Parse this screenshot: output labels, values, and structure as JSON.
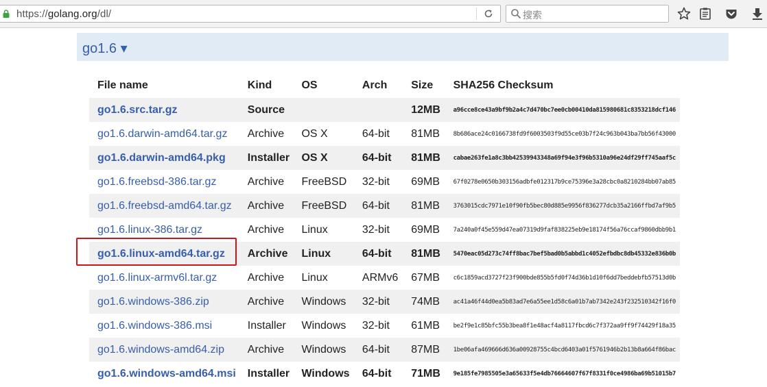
{
  "browser": {
    "url_prefix": "https://",
    "url_host": "golang.org",
    "url_path": "/dl/",
    "search_placeholder": "搜索",
    "icons": [
      "lock-icon",
      "reload-icon",
      "search-icon",
      "bookmark-star-icon",
      "reading-list-icon",
      "pocket-icon",
      "download-icon"
    ]
  },
  "release": {
    "title": "go1.6 ▾"
  },
  "table": {
    "headers": [
      "File name",
      "Kind",
      "OS",
      "Arch",
      "Size",
      "SHA256 Checksum"
    ],
    "rows": [
      {
        "file": "go1.6.src.tar.gz",
        "kind": "Source",
        "os": "",
        "arch": "",
        "size": "12MB",
        "sha": "a96cce8ce43a9bf9b2a4c7d470bc7ee0cb00410da815980681c8353218dcf146",
        "highlight": true
      },
      {
        "file": "go1.6.darwin-amd64.tar.gz",
        "kind": "Archive",
        "os": "OS X",
        "arch": "64-bit",
        "size": "81MB",
        "sha": "8b686ace24c0166738fd9f6003503f9d55ce03b7f24c963b043ba7bb56f43000",
        "highlight": false
      },
      {
        "file": "go1.6.darwin-amd64.pkg",
        "kind": "Installer",
        "os": "OS X",
        "arch": "64-bit",
        "size": "81MB",
        "sha": "cabae263fe1a8c3bb42539943348a69f94e3f96b5310a96e24df29ff745aaf5c",
        "highlight": true
      },
      {
        "file": "go1.6.freebsd-386.tar.gz",
        "kind": "Archive",
        "os": "FreeBSD",
        "arch": "32-bit",
        "size": "69MB",
        "sha": "67f0278e0650b303156adbfe012317b9ce75396e3a28cbc0a8210284bb07ab85",
        "highlight": false
      },
      {
        "file": "go1.6.freebsd-amd64.tar.gz",
        "kind": "Archive",
        "os": "FreeBSD",
        "arch": "64-bit",
        "size": "81MB",
        "sha": "3763015cdc7971e10f90fb5bec80d885e9956f836277dcb35a2166ffbd7af9b5",
        "highlight": false
      },
      {
        "file": "go1.6.linux-386.tar.gz",
        "kind": "Archive",
        "os": "Linux",
        "arch": "32-bit",
        "size": "69MB",
        "sha": "7a240a0f45e559d47ea07319d9faf838225eb9e18174f56a76ccaf9860dbb9b1",
        "highlight": false
      },
      {
        "file": "go1.6.linux-amd64.tar.gz",
        "kind": "Archive",
        "os": "Linux",
        "arch": "64-bit",
        "size": "81MB",
        "sha": "5470eac05d273c74ff8bac7bef5bad0b5abbd1c4052efbdbc8db45332e836b0b",
        "highlight": true
      },
      {
        "file": "go1.6.linux-armv6l.tar.gz",
        "kind": "Archive",
        "os": "Linux",
        "arch": "ARMv6",
        "size": "67MB",
        "sha": "c6c1859acd3727f23f900bde855b5fd0f74d36b1d10f6dd7beddebfb57513d0b",
        "highlight": false
      },
      {
        "file": "go1.6.windows-386.zip",
        "kind": "Archive",
        "os": "Windows",
        "arch": "32-bit",
        "size": "74MB",
        "sha": "ac41a46f44d0ea5b83ad7e6a55ee1d58c6a01b7ab7342e243f232510342f16f0",
        "highlight": false
      },
      {
        "file": "go1.6.windows-386.msi",
        "kind": "Installer",
        "os": "Windows",
        "arch": "32-bit",
        "size": "61MB",
        "sha": "be2f9e1c85bfc55b3bea8f1e48acf4a8117fbcd6c7f372aa9ff9f74429f18a35",
        "highlight": false
      },
      {
        "file": "go1.6.windows-amd64.zip",
        "kind": "Archive",
        "os": "Windows",
        "arch": "64-bit",
        "size": "87MB",
        "sha": "1be06afa469666d636a00928755c4bcd6403a01f5761946b2b13b8a664f86bac",
        "highlight": false
      },
      {
        "file": "go1.6.windows-amd64.msi",
        "kind": "Installer",
        "os": "Windows",
        "arch": "64-bit",
        "size": "71MB",
        "sha": "9e185fe7985505e3a65633f5e4db76664607f67f8331f0ce4986ba69b51015b7",
        "highlight": true
      }
    ]
  },
  "annotation": {
    "boxed_row": "go1.6.linux-amd64.tar.gz",
    "box_color": "#d0141c"
  },
  "colors": {
    "link": "#375eab",
    "version_bar": "#e0ebf5",
    "row_shade": "#f0f0f0"
  }
}
